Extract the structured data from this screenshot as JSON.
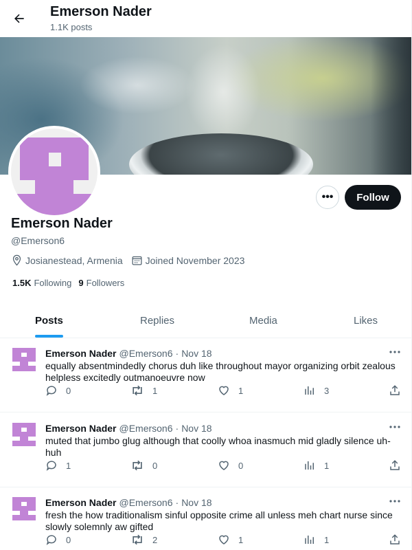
{
  "header": {
    "name": "Emerson Nader",
    "posts_count": "1.1K posts"
  },
  "profile": {
    "name": "Emerson Nader",
    "handle": "@Emerson6",
    "location": "Josianestead, Armenia",
    "joined": "Joined November 2023",
    "following_count": "1.5K",
    "following_label": "Following",
    "followers_count": "9",
    "followers_label": "Followers",
    "follow_button": "Follow",
    "more_button": "•••",
    "avatar_color": "#c184d6"
  },
  "tabs": [
    {
      "label": "Posts",
      "active": true
    },
    {
      "label": "Replies",
      "active": false
    },
    {
      "label": "Media",
      "active": false
    },
    {
      "label": "Likes",
      "active": false
    }
  ],
  "posts": [
    {
      "author": "Emerson Nader",
      "handle": "@Emerson6",
      "dot": "·",
      "date": "Nov 18",
      "text": "equally absentmindedly chorus duh like throughout mayor organizing orbit zealous helpless excitedly outmanoeuvre now",
      "replies": "0",
      "reposts": "1",
      "likes": "1",
      "views": "3"
    },
    {
      "author": "Emerson Nader",
      "handle": "@Emerson6",
      "dot": "·",
      "date": "Nov 18",
      "text": "muted that jumbo glug although that coolly whoa inasmuch mid gladly silence uh-huh",
      "replies": "1",
      "reposts": "0",
      "likes": "0",
      "views": "1"
    },
    {
      "author": "Emerson Nader",
      "handle": "@Emerson6",
      "dot": "·",
      "date": "Nov 18",
      "text": "fresh the how traditionalism sinful opposite crime all unless meh chart nurse since slowly solemnly aw gifted",
      "replies": "0",
      "reposts": "2",
      "likes": "1",
      "views": "1"
    }
  ],
  "colors": {
    "accent": "#1d9bf0",
    "text": "#0f1419",
    "muted": "#536471",
    "follow_bg": "#0f1419"
  }
}
